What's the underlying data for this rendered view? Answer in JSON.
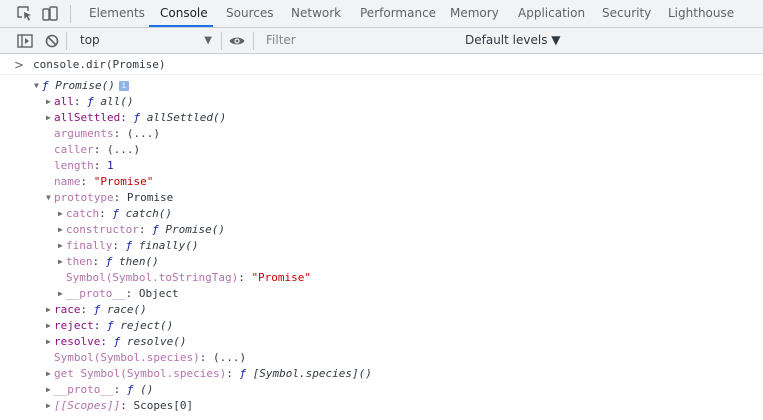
{
  "tabs": [
    {
      "label": "Elements"
    },
    {
      "label": "Console",
      "active": true
    },
    {
      "label": "Sources"
    },
    {
      "label": "Network"
    },
    {
      "label": "Performance"
    },
    {
      "label": "Memory"
    },
    {
      "label": "Application"
    },
    {
      "label": "Security"
    },
    {
      "label": "Lighthouse"
    }
  ],
  "icons": {
    "inspect": "inspect-element-icon",
    "device": "device-toolbar-icon",
    "sidebar": "console-sidebar-icon",
    "clear": "clear-console-icon",
    "eye": "live-expression-eye-icon",
    "info": "info-icon"
  },
  "toolbar": {
    "context": "top",
    "filter_placeholder": "Filter",
    "levels": "Default levels ▼"
  },
  "console": {
    "prompt": ">",
    "command": "console.dir(Promise)",
    "root": {
      "f": "ƒ",
      "name": "Promise()",
      "info": "i"
    },
    "all": {
      "key": "all",
      "f": "ƒ",
      "fn": "all()"
    },
    "allSettled": {
      "key": "allSettled",
      "f": "ƒ",
      "fn": "allSettled()"
    },
    "arguments": {
      "key": "arguments",
      "value": "(...)"
    },
    "caller": {
      "key": "caller",
      "value": "(...)"
    },
    "length": {
      "key": "length",
      "value": "1"
    },
    "name": {
      "key": "name",
      "value": "\"Promise\""
    },
    "prototype": {
      "key": "prototype",
      "value": "Promise"
    },
    "catch": {
      "key": "catch",
      "f": "ƒ",
      "fn": "catch()"
    },
    "constructor": {
      "key": "constructor",
      "f": "ƒ",
      "fn": "Promise()"
    },
    "finally": {
      "key": "finally",
      "f": "ƒ",
      "fn": "finally()"
    },
    "then": {
      "key": "then",
      "f": "ƒ",
      "fn": "then()"
    },
    "tostringtag": {
      "key": "Symbol(Symbol.toStringTag)",
      "value": "\"Promise\""
    },
    "proto_inner": {
      "key": "__proto__",
      "value": "Object"
    },
    "race": {
      "key": "race",
      "f": "ƒ",
      "fn": "race()"
    },
    "reject": {
      "key": "reject",
      "f": "ƒ",
      "fn": "reject()"
    },
    "resolve": {
      "key": "resolve",
      "f": "ƒ",
      "fn": "resolve()"
    },
    "species": {
      "key": "Symbol(Symbol.species)",
      "value": "(...)"
    },
    "get_species": {
      "key": "get Symbol(Symbol.species)",
      "f": "ƒ",
      "fn": "[Symbol.species]()"
    },
    "proto": {
      "key": "__proto__",
      "f": "ƒ",
      "fn": "()"
    },
    "scopes": {
      "key": "[[Scopes]]",
      "value": "Scopes[0]"
    }
  },
  "colors": {
    "accent": "#1a73e8",
    "key": "#881280",
    "key_dim": "#b373ad",
    "string": "#c80000",
    "number": "#1a1aa6",
    "function": "#0d22aa"
  }
}
